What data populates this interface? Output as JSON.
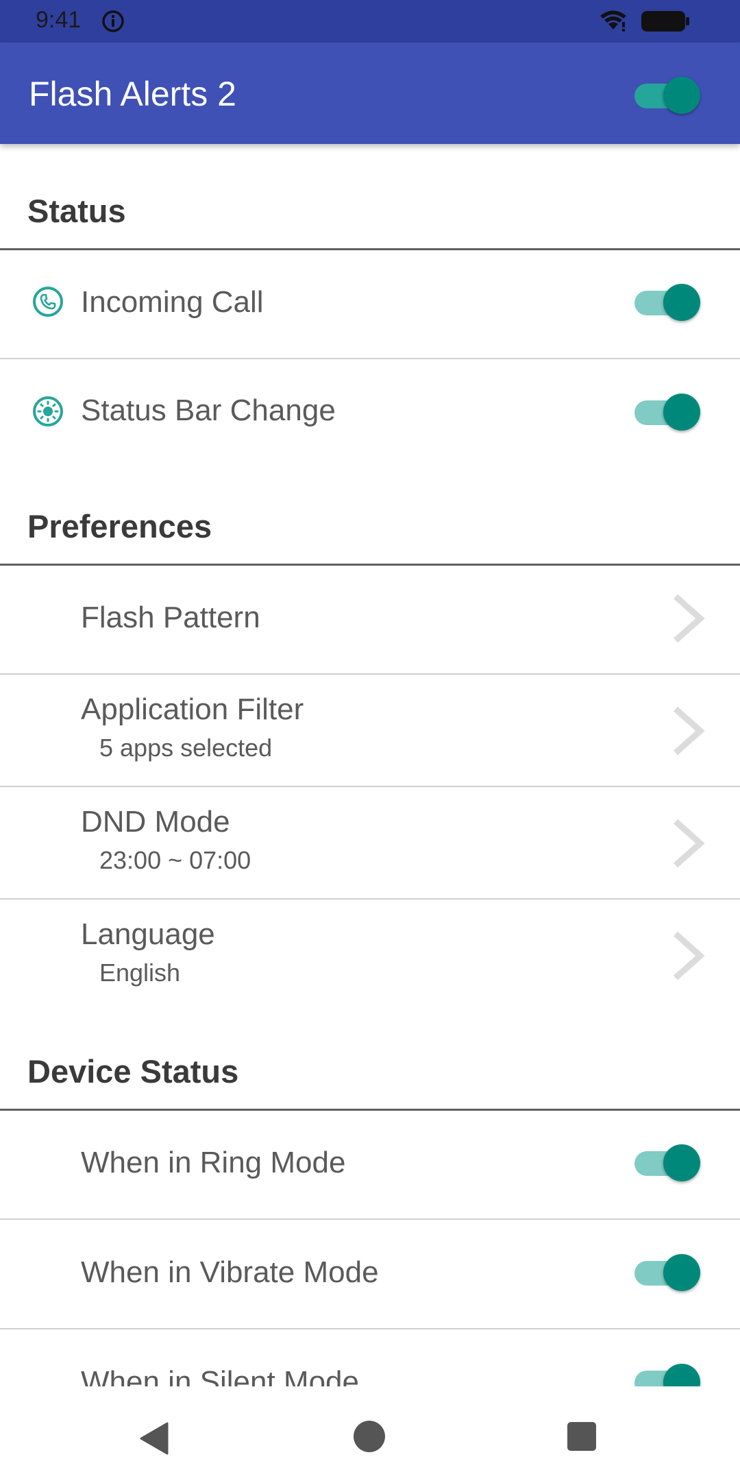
{
  "status_bar": {
    "time": "9:41",
    "icons": [
      "info-icon",
      "wifi-icon",
      "battery-icon"
    ]
  },
  "app_bar": {
    "title": "Flash Alerts 2",
    "master_switch_on": true,
    "color": "#3f51b5"
  },
  "sections": {
    "status": {
      "header": "Status",
      "items": [
        {
          "label": "Incoming Call",
          "icon": "phone-icon",
          "on": true
        },
        {
          "label": "Status Bar Change",
          "icon": "notification-gear-icon",
          "on": true
        }
      ]
    },
    "preferences": {
      "header": "Preferences",
      "items": [
        {
          "label": "Flash Pattern",
          "sub": ""
        },
        {
          "label": "Application Filter",
          "sub": "5 apps selected"
        },
        {
          "label": "DND Mode",
          "sub": "23:00 ~ 07:00"
        },
        {
          "label": "Language",
          "sub": "English"
        }
      ]
    },
    "device_status": {
      "header": "Device Status",
      "items": [
        {
          "label": "When in Ring Mode",
          "on": true
        },
        {
          "label": "When in Vibrate Mode",
          "on": true
        },
        {
          "label": "When in Silent Mode",
          "on": true
        }
      ]
    }
  },
  "colors": {
    "accent": "#00897b",
    "accent_track": "#80cbc4",
    "icon_tint": "#26a69a"
  },
  "nav_bar": {
    "buttons": [
      "back-icon",
      "home-icon",
      "recents-icon"
    ]
  }
}
